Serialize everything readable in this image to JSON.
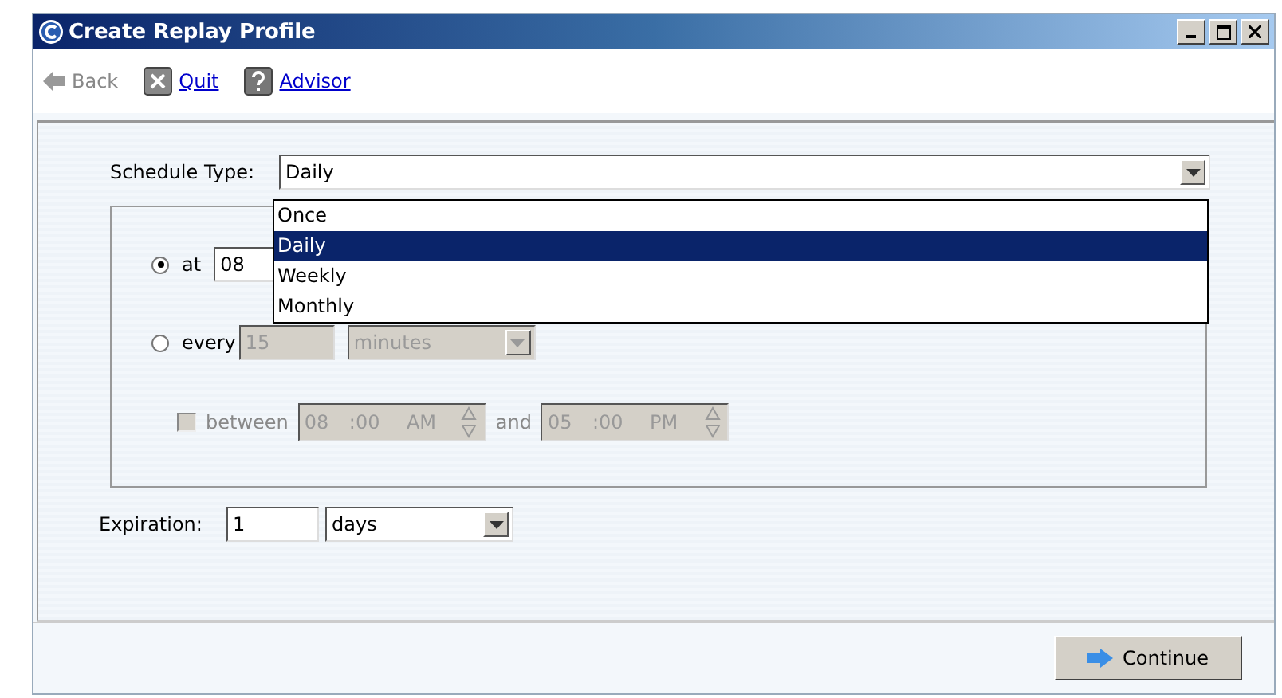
{
  "window": {
    "title": "Create Replay Profile"
  },
  "toolbar": [
    {
      "kind": "back",
      "label": "Back",
      "disabled": true
    },
    {
      "kind": "quit",
      "label": "Quit",
      "disabled": false
    },
    {
      "kind": "advisor",
      "label": "Advisor",
      "disabled": false
    }
  ],
  "schedule_type": {
    "label": "Schedule Type:",
    "value": "Daily",
    "expanded": true,
    "options": [
      {
        "label": "Once",
        "selected": false
      },
      {
        "label": "Daily",
        "selected": true
      },
      {
        "label": "Weekly",
        "selected": false
      },
      {
        "label": "Monthly",
        "selected": false
      }
    ]
  },
  "schedule": {
    "at": {
      "label": "at",
      "selected": true,
      "hour": "08"
    },
    "every": {
      "label": "every",
      "selected": false,
      "value": "15",
      "unit": "minutes",
      "disabled": true
    },
    "between": {
      "label": "between",
      "checked": false,
      "disabled": true,
      "and_label": "and",
      "from": {
        "hour": "08",
        "separator": ":",
        "minute": "00",
        "ampm": "AM"
      },
      "to": {
        "hour": "05",
        "separator": ":",
        "minute": "00",
        "ampm": "PM"
      }
    }
  },
  "expiration": {
    "label": "Expiration:",
    "value": "1",
    "unit": "days"
  },
  "continue_button": {
    "label": "Continue"
  }
}
